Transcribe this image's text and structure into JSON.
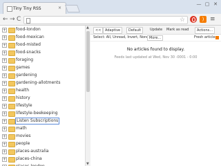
{
  "browser": {
    "tab_title": "Tiny Tiny RSS",
    "tab_close": "×",
    "window_buttons": [
      "—",
      "▢",
      "✕"
    ],
    "back": "←",
    "forward": "→",
    "reload": "C",
    "star": "☆",
    "menu": "≡"
  },
  "feeds": [
    {
      "label": "food-london"
    },
    {
      "label": "food-mexican"
    },
    {
      "label": "food-misted"
    },
    {
      "label": "food-snacks"
    },
    {
      "label": "foraging"
    },
    {
      "label": "games"
    },
    {
      "label": "gardening"
    },
    {
      "label": "gardening-allotments"
    },
    {
      "label": "health"
    },
    {
      "label": "history"
    },
    {
      "label": "lifestyle"
    },
    {
      "label": "lifestyle-beekeeping"
    },
    {
      "label": "Listen Subscriptions"
    },
    {
      "label": "math"
    },
    {
      "label": "movies"
    },
    {
      "label": "people"
    },
    {
      "label": "places-australia"
    },
    {
      "label": "places-china"
    },
    {
      "label": "places-london"
    }
  ],
  "feed_expander": "+",
  "scroll": {
    "up": "▲",
    "down": "▼"
  },
  "headlines_toolbar": {
    "collapse": "<<",
    "view_mode": "Adaptive",
    "order": "Default",
    "update": "Update",
    "mark_as_read": "Mark as read",
    "actions": "Actions..."
  },
  "select_bar": {
    "prefix": "Select: All, Unread, Invert, None",
    "more": "More...",
    "fresh": "Fresh articles"
  },
  "messages": {
    "no_articles": "No articles found to display.",
    "last_updated": "Feeds last updated at Wed, Nov 30 -0001 - 0:00"
  }
}
